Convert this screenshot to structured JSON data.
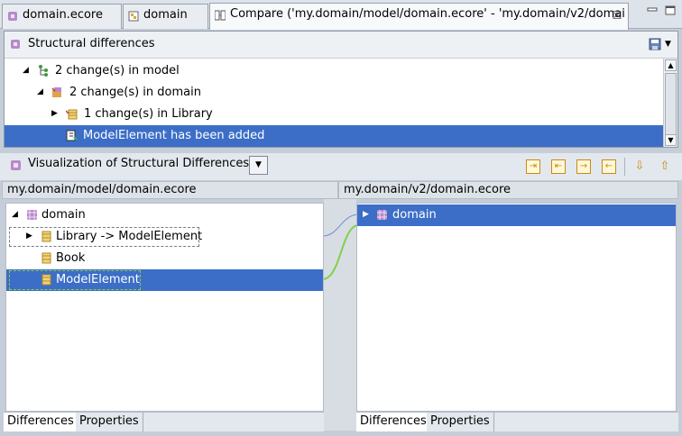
{
  "tabs": [
    {
      "label": "domain.ecore",
      "icon": "ecore-package-icon",
      "active": false
    },
    {
      "label": "domain",
      "icon": "diagram-icon",
      "active": false
    },
    {
      "label": "Compare ('my.domain/model/domain.ecore' - 'my.domain/v2/domai",
      "icon": "compare-icon",
      "active": true
    }
  ],
  "structural": {
    "title": "Structural differences",
    "rows": [
      {
        "label": "2 change(s) in model",
        "icon": "model-tree-icon"
      },
      {
        "label": "2 change(s) in domain",
        "icon": "package-change-icon"
      },
      {
        "label": "1 change(s) in Library",
        "icon": "class-change-icon"
      },
      {
        "label": "ModelElement has been added",
        "icon": "add-element-icon"
      }
    ]
  },
  "visualization": {
    "title": "Visualization of Structural Differences"
  },
  "left_pane": {
    "path": "my.domain/model/domain.ecore",
    "rows": [
      {
        "label": "domain"
      },
      {
        "label": "Library -> ModelElement"
      },
      {
        "label": "Book"
      },
      {
        "label": "ModelElement"
      }
    ],
    "tabs": [
      "Differences",
      "Properties"
    ]
  },
  "right_pane": {
    "path": "my.domain/v2/domain.ecore",
    "rows": [
      {
        "label": "domain"
      }
    ],
    "tabs": [
      "Differences",
      "Properties"
    ]
  },
  "colors": {
    "selection": "#3c6ec7",
    "added_link": "#7ed14a",
    "changed_link": "#6b8fc9"
  }
}
